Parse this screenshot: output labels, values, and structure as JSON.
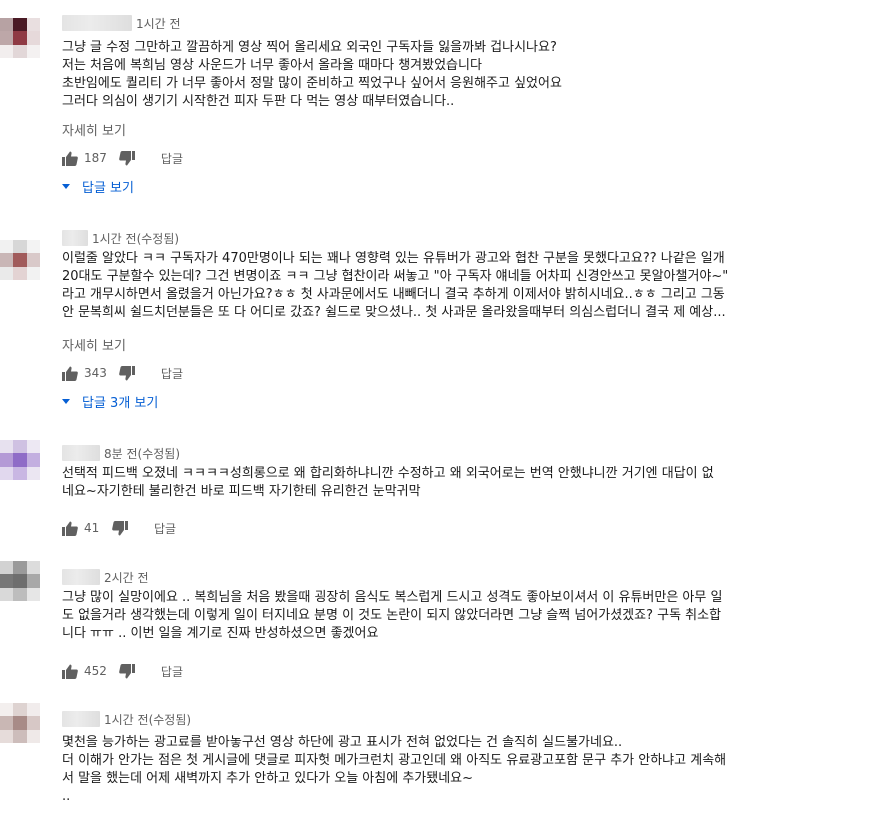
{
  "comments": [
    {
      "time": "1시간 전",
      "avatar_colors": [
        "#b7a2a3",
        "#4a1a25",
        "#e9dfe0",
        "#bda7a8",
        "#8f3a44",
        "#e6d9da",
        "#f2eeee",
        "#e2d7d8",
        "#f4f1f1"
      ],
      "lines": [
        "그냥 글 수정 그만하고 깔끔하게 영상 찍어 올리세요 외국인 구독자들 잃을까봐 겁나시나요?",
        "저는 처음에 복희님 영상 사운드가 너무 좋아서 올라올 때마다 챙겨봤었습니다",
        "초반임에도 퀄리티 가 너무 좋아서 정말 많이 준비하고 찍었구나 싶어서 응원해주고 싶었어요",
        "그러다 의심이 생기기 시작한건 피자 두판 다 먹는 영상 때부터였습니다.."
      ],
      "more": "자세히 보기",
      "likes": "187",
      "reply": "답글",
      "view_replies": "답글 보기"
    },
    {
      "time": "1시간 전(수정됨)",
      "avatar_colors": [
        "#f1f1f1",
        "#d7d7d7",
        "#f3f3f3",
        "#c9b6b6",
        "#a15b5b",
        "#d9c9c9",
        "#eaeaea",
        "#e3d3d3",
        "#f2f2f2"
      ],
      "lines": [
        "이럴줄 알았다 ㅋㅋ 구독자가 470만명이나 되는 꽤나 영향력 있는 유튜버가  광고와 협찬 구분을 못했다고요?? 나같은 일개",
        "20대도 구분할수 있는데? 그건 변명이죠 ㅋㅋ 그냥 협찬이라 써놓고 \"아 구독자 얘네들 어차피 신경안쓰고 못알아챌거야~\"",
        "라고 개무시하면서 올렸을거 아닌가요?ㅎㅎ 첫 사과문에서도 내빼더니 결국 추하게 이제서야 밝히시네요..ㅎㅎ 그리고 그동",
        "안 문복희씨 쉴드치던분들은 또 다 어디로 갔죠? 쉴드로 맞으셨나.. 첫 사과문 올라왔을때부터 의심스럽더니 결국 제 예상..."
      ],
      "more": "자세히 보기",
      "likes": "343",
      "reply": "답글",
      "view_replies": "답글 3개 보기"
    },
    {
      "time": "8분 전(수정됨)",
      "avatar_colors": [
        "#e7e1ef",
        "#cfc1e2",
        "#ede8f3",
        "#b49ad6",
        "#8f6cc7",
        "#c3afe0",
        "#e1d8ee",
        "#c9b7e3",
        "#ebe6f2"
      ],
      "lines": [
        "선택적 피드백 오졌네 ㅋㅋㅋㅋ성희롱으로 왜 합리화하냐니깐 수정하고 왜 외국어로는 번역 안했냐니깐 거기엔 대답이 없",
        "네요~자기한테 불리한건 바로 피드백 자기한테 유리한건 눈막귀막"
      ],
      "likes": "41",
      "reply": "답글"
    },
    {
      "time": "2시간 전",
      "avatar_colors": [
        "#d2d2d2",
        "#9a9a9a",
        "#dcdcdc",
        "#777777",
        "#6e6e6e",
        "#a8a8a8",
        "#d9d9d9",
        "#bdbdbd",
        "#e6e6e6"
      ],
      "lines": [
        "그냥 많이 실망이에요 .. 복희님을 처음 봤을때 굉장히 음식도 복스럽게 드시고 성격도 좋아보이셔서 이 유튜버만은 아무 일",
        "도 없을거라 생각했는데 이렇게 일이 터지네요 분명 이 것도 논란이 되지 않았더라면 그냥 슬쩍 넘어가셨겠죠? 구독 취소합",
        "니다 ㅠㅠ .. 이번 일을 계기로 진짜 반성하셨으면 좋겠어요"
      ],
      "likes": "452",
      "reply": "답글"
    },
    {
      "time": "1시간 전(수정됨)",
      "avatar_colors": [
        "#f3efee",
        "#ded3d1",
        "#f1ecec",
        "#c9b7b4",
        "#a88b87",
        "#d7c8c6",
        "#e6dcda",
        "#cdbdbb",
        "#efe9e8"
      ],
      "lines": [
        "몇천을 능가하는 광고료를 받아놓구선 영상 하단에 광고 표시가 전혀 없었다는 건 솔직히 실드불가네요..",
        "더 이해가 안가는 점은 첫 게시글에 댓글로 피자헛 메가크런치 광고인데 왜 아직도 유료광고포함 문구 추가 안하냐고 계속해",
        "서 말을 했는데 어제 새벽까지 추가 안하고 있다가 오늘 아침에 추가됐네요~",
        ".."
      ]
    }
  ]
}
